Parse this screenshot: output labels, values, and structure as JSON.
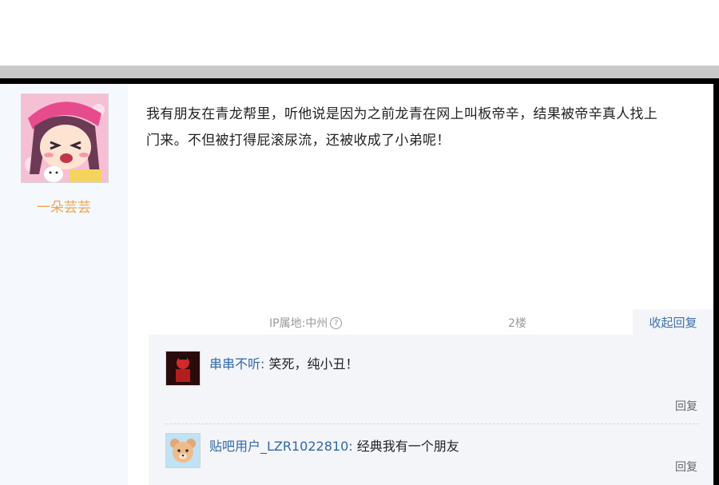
{
  "post": {
    "username": "一朵芸芸",
    "content": "我有朋友在青龙帮里，听他说是因为之前龙青在网上叫板帝辛，结果被帝辛真人找上\n门来。不但被打得屁滚尿流，还被收成了小弟呢！",
    "ip_location": "IP属地:中州",
    "floor": "2楼",
    "collapse_label": "收起回复",
    "avatar_icon": "anime-girl-avatar"
  },
  "replies": [
    {
      "name": "串串不听",
      "separator": ":",
      "text": "笑死，纯小丑！",
      "reply_label": "回复",
      "avatar_icon": "red-figure-avatar"
    },
    {
      "name": "贴吧用户_LZR1022810",
      "separator": ":",
      "text": "经典我有一个朋友",
      "reply_label": "回复",
      "avatar_icon": "bear-avatar"
    }
  ],
  "colors": {
    "username": "#f0a34a",
    "link_blue": "#2f68a8",
    "reply_bg": "#f3f5f8",
    "left_col_bg": "#f5f8fc"
  }
}
